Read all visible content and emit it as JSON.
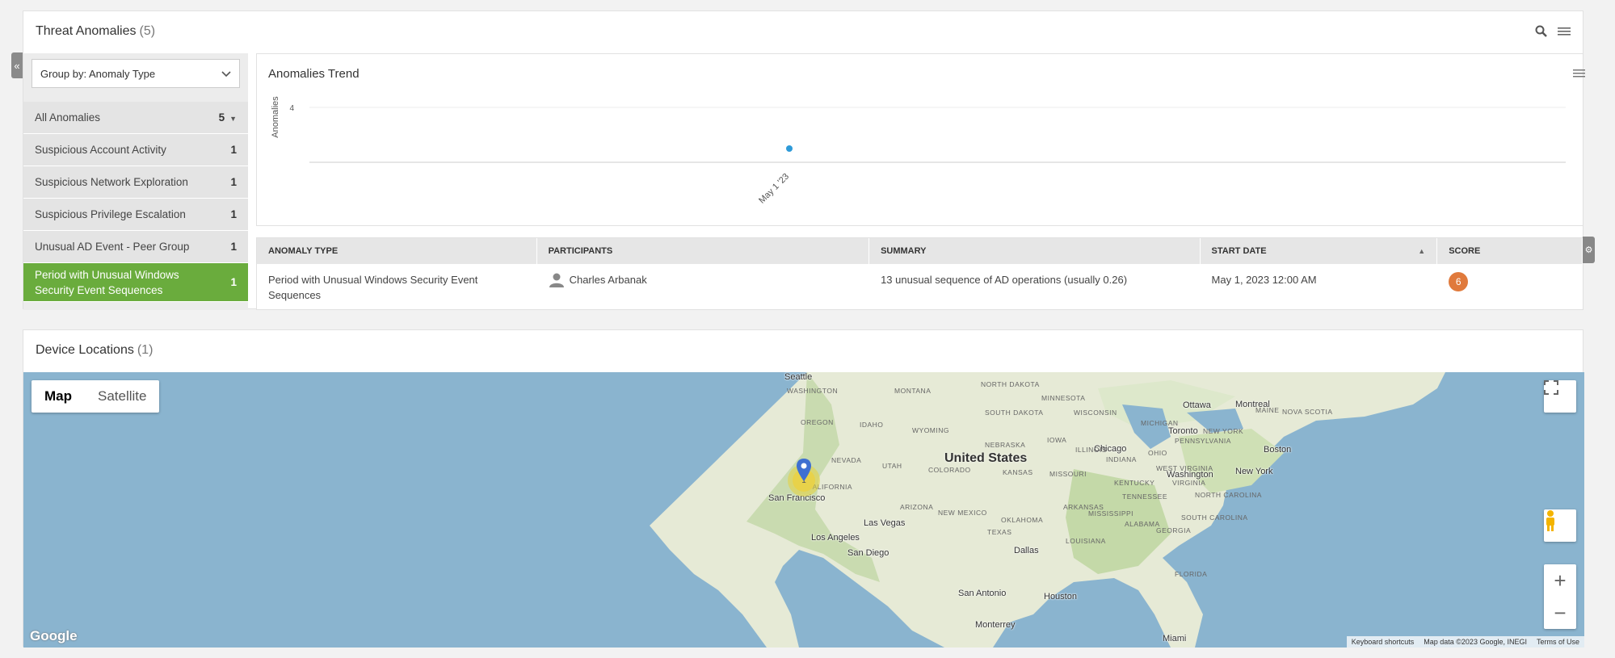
{
  "threat": {
    "title": "Threat Anomalies",
    "count": "(5)",
    "group_by": "Group by: Anomaly Type",
    "items": [
      {
        "label": "All Anomalies",
        "count": "5"
      },
      {
        "label": "Suspicious Account Activity",
        "count": "1"
      },
      {
        "label": "Suspicious Network Exploration",
        "count": "1"
      },
      {
        "label": "Suspicious Privilege Escalation",
        "count": "1"
      },
      {
        "label": "Unusual AD Event - Peer Group",
        "count": "1"
      },
      {
        "label": "Period with Unusual Windows Security Event Sequences",
        "count": "1"
      }
    ]
  },
  "trend": {
    "title": "Anomalies Trend"
  },
  "chart_data": {
    "type": "scatter",
    "title": "Anomalies Trend",
    "xlabel": "",
    "ylabel": "Anomalies",
    "x": [
      "May 1 '23"
    ],
    "y": [
      1
    ],
    "y_ticks": [
      "4"
    ],
    "point_color": "#2e9ad8",
    "grid": true
  },
  "table": {
    "headers": [
      "ANOMALY TYPE",
      "PARTICIPANTS",
      "SUMMARY",
      "START DATE",
      "SCORE"
    ],
    "rows": [
      {
        "type": "Period with Unusual Windows Security Event Sequences",
        "participant": "Charles Arbanak",
        "summary": "13 unusual sequence of AD operations (usually 0.26)",
        "start": "May 1, 2023 12:00 AM",
        "score": "6"
      }
    ]
  },
  "devices": {
    "title": "Device Locations",
    "count": "(1)",
    "map_btn": "Map",
    "sat_btn": "Satellite",
    "country": "United States",
    "cities": [
      "Seattle",
      "San Francisco",
      "Las Vegas",
      "Los Angeles",
      "San Diego",
      "Dallas",
      "Houston",
      "San Antonio",
      "Monterrey",
      "Chicago",
      "Toronto",
      "Ottawa",
      "Montreal",
      "Boston",
      "New York",
      "Washington",
      "Miami"
    ],
    "states": [
      "WASHINGTON",
      "MONTANA",
      "NORTH DAKOTA",
      "MINNESOTA",
      "OREGON",
      "IDAHO",
      "SOUTH DAKOTA",
      "WISCONSIN",
      "MICHIGAN",
      "WYOMING",
      "NEBRASKA",
      "IOWA",
      "NEVADA",
      "UTAH",
      "COLORADO",
      "ILLINOIS",
      "INDIANA",
      "OHIO",
      "KANSAS",
      "MISSOURI",
      "KENTUCKY",
      "VIRGINIA",
      "WEST VIRGINIA",
      "PENNSYLVANIA",
      "NEW YORK",
      "MAINE",
      "NOVA SCOTIA",
      "CALIFORNIA",
      "ARIZONA",
      "NEW MEXICO",
      "OKLAHOMA",
      "ARKANSAS",
      "TENNESSEE",
      "NORTH CAROLINA",
      "SOUTH CAROLINA",
      "MISSISSIPPI",
      "ALABAMA",
      "GEORGIA",
      "LOUISIANA",
      "TEXAS",
      "FLORIDA"
    ],
    "cluster_count": "1",
    "google": "Google",
    "attrib": [
      "Keyboard shortcuts",
      "Map data ©2023 Google, INEGI",
      "Terms of Use"
    ]
  }
}
